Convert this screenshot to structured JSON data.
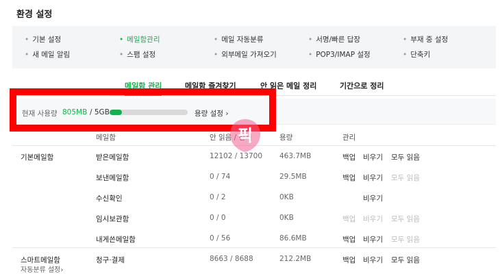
{
  "page_title": "환경 설정",
  "settings_menu": [
    {
      "label": "기본 설정",
      "active": false
    },
    {
      "label": "메일함관리",
      "active": true
    },
    {
      "label": "메일 자동분류",
      "active": false
    },
    {
      "label": "서명/빠른 답장",
      "active": false
    },
    {
      "label": "부재 중 설정",
      "active": false
    },
    {
      "label": "새 메일 알림",
      "active": false
    },
    {
      "label": "스팸 설정",
      "active": false
    },
    {
      "label": "외부메일 가져오기",
      "active": false
    },
    {
      "label": "POP3/IMAP 설정",
      "active": false
    },
    {
      "label": "단축키",
      "active": false
    }
  ],
  "tabs": [
    {
      "label": "메일함 관리",
      "active": true
    },
    {
      "label": "메일함 즐겨찾기",
      "active": false
    },
    {
      "label": "안 읽은 메일 정리",
      "active": false
    },
    {
      "label": "기간으로 정리",
      "active": false
    }
  ],
  "usage": {
    "label": "현재 사용량",
    "used": "805MB",
    "total": "/ 5GB",
    "fraction": 0.16,
    "setting_link": "용량 설정 ›"
  },
  "columns": {
    "mailbox": "메일함",
    "count": "안 읽음 / 전체",
    "size": "용량",
    "manage": "관리"
  },
  "groups": [
    {
      "category": "기본메일함",
      "rows": [
        {
          "name": "받은메일함",
          "count": "12102 / 13700",
          "size": "463.7MB",
          "backup": "백업",
          "backup_enabled": true,
          "empty": "비우기",
          "empty_enabled": true,
          "read_all": "모두 읽음",
          "read_all_enabled": true
        },
        {
          "name": "보낸메일함",
          "count": "0 / 74",
          "size": "29.5MB",
          "backup": "백업",
          "backup_enabled": true,
          "empty": "비우기",
          "empty_enabled": true,
          "read_all": "모두 읽음",
          "read_all_enabled": false
        },
        {
          "name": "수신확인",
          "count": "0 / 2",
          "size": "0KB",
          "backup": "",
          "backup_enabled": false,
          "empty": "비우기",
          "empty_enabled": true,
          "read_all": "",
          "read_all_enabled": false
        },
        {
          "name": "임시보관함",
          "count": "0 / 0",
          "size": "0KB",
          "backup": "백업",
          "backup_enabled": false,
          "empty": "비우기",
          "empty_enabled": false,
          "read_all": "모두 읽음",
          "read_all_enabled": false
        },
        {
          "name": "내게쓴메일함",
          "count": "0 / 56",
          "size": "86.6MB",
          "backup": "백업",
          "backup_enabled": true,
          "empty": "비우기",
          "empty_enabled": true,
          "read_all": "모두 읽음",
          "read_all_enabled": false
        }
      ]
    },
    {
      "category": "스마트메일함",
      "sublink": "자동분류 설정›",
      "rows": [
        {
          "name": "청구·결제",
          "count": "8663 / 8688",
          "size": "212.2MB",
          "backup": "백업",
          "backup_enabled": true,
          "empty": "비우기",
          "empty_enabled": true,
          "read_all": "모두 읽음",
          "read_all_enabled": true
        }
      ]
    }
  ],
  "watermark_text": "픽",
  "colors": {
    "accent": "#12b34c",
    "highlight_frame": "#ff0000",
    "watermark": "#f06292",
    "menu_bg": "#f3f5f7"
  }
}
